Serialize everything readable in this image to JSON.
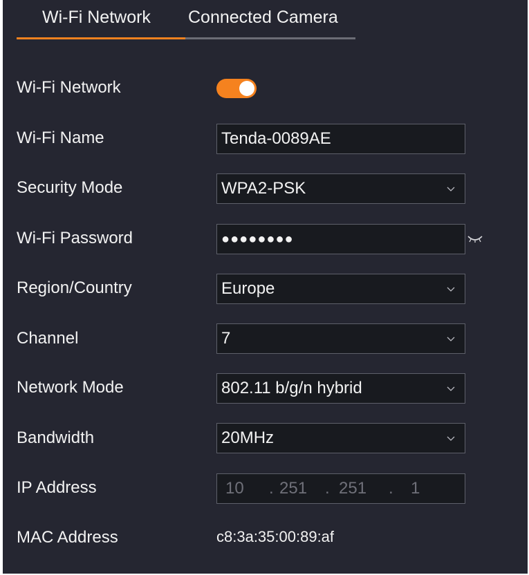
{
  "tabs": [
    {
      "label": "Wi-Fi Network",
      "active": true
    },
    {
      "label": "Connected Camera",
      "active": false
    }
  ],
  "colors": {
    "accent": "#f5821f",
    "panel_background": "#252631",
    "field_background": "#181a1f",
    "field_border": "#5e606a",
    "disabled_text": "#6f7079"
  },
  "form": {
    "wifi_network": {
      "label": "Wi-Fi Network",
      "enabled": true
    },
    "wifi_name": {
      "label": "Wi-Fi Name",
      "value": "Tenda-0089AE"
    },
    "security_mode": {
      "label": "Security Mode",
      "value": "WPA2-PSK"
    },
    "wifi_password": {
      "label": "Wi-Fi Password",
      "masked_value": "●●●●●●●●",
      "visibility_icon": "closed-eye-icon"
    },
    "region": {
      "label": "Region/Country",
      "value": "Europe"
    },
    "channel": {
      "label": "Channel",
      "value": "7"
    },
    "network_mode": {
      "label": "Network Mode",
      "value": "802.11 b/g/n hybrid"
    },
    "bandwidth": {
      "label": "Bandwidth",
      "value": "20MHz"
    },
    "ip_address": {
      "label": "IP Address",
      "octets": [
        "10",
        "251",
        "251",
        "1"
      ],
      "separator": "."
    },
    "mac_address": {
      "label": "MAC Address",
      "value": "c8:3a:35:00:89:af"
    }
  }
}
